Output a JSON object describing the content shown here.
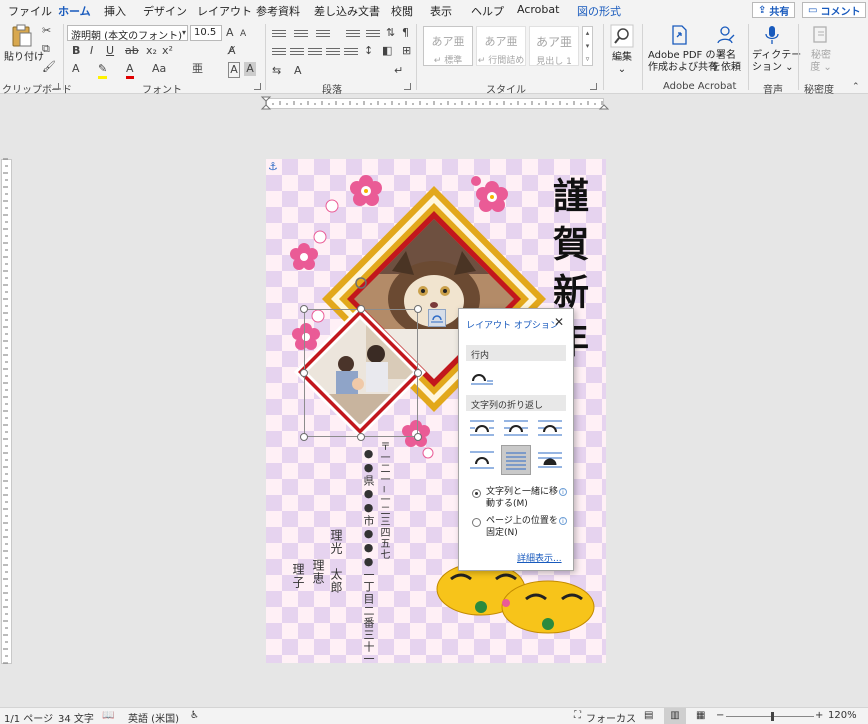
{
  "tabs": [
    "ファイル",
    "ホーム",
    "挿入",
    "デザイン",
    "レイアウト",
    "参考資料",
    "差し込み文書",
    "校閲",
    "表示",
    "ヘルプ",
    "Acrobat",
    "図の形式"
  ],
  "active_tab": "ホーム",
  "share_label": "共有",
  "comment_label": "コメント",
  "clipboard": {
    "paste_label": "貼り付け",
    "group_label": "クリップボード"
  },
  "font": {
    "name": "游明朝 (本文のフォント)",
    "size": "10.5",
    "group_label": "フォント"
  },
  "paragraph": {
    "group_label": "段落"
  },
  "styles": {
    "preview": "あア亜",
    "items": [
      "標準",
      "行間詰め",
      "見出し 1"
    ],
    "group_label": "スタイル"
  },
  "editing": {
    "label": "編集"
  },
  "adobe": {
    "create_label_1": "Adobe PDF の",
    "create_label_2": "作成および共有",
    "sign_label_1": "署名",
    "sign_label_2": "を依頼",
    "group_label": "Adobe Acrobat"
  },
  "voice": {
    "dictate_label_1": "ディクテー",
    "dictate_label_2": "ション",
    "group_label": "音声"
  },
  "sensitivity": {
    "label_1": "秘密",
    "label_2": "度",
    "group_label": "秘密度"
  },
  "document": {
    "greeting": "謹賀新年",
    "postal": "〒一二一−一二三四五七",
    "address": "●●県●●市●●●一丁目二番三十一号",
    "names": [
      "理光　太郎",
      "理恵",
      "理子"
    ]
  },
  "layout_popup": {
    "title": "レイアウト オプション",
    "inline_section": "行内",
    "wrap_section": "文字列の折り返し",
    "option_move_1": "文字列と一緒に移",
    "option_move_2": "動する(M)",
    "option_fix_1": "ページ上の位置を",
    "option_fix_2": "固定(N)",
    "selected_option": "move_with_text",
    "more_link": "詳細表示..."
  },
  "status": {
    "page": "1/1 ページ",
    "words": "34 文字",
    "language": "英語 (米国)",
    "focus": "フォーカス",
    "zoom": "120%"
  },
  "colors": {
    "accent": "#185abd",
    "frame_gold": "#e2a81b",
    "frame_red": "#c2171d",
    "font_red": "#e00000",
    "plum_pink": "#ea5b96"
  }
}
